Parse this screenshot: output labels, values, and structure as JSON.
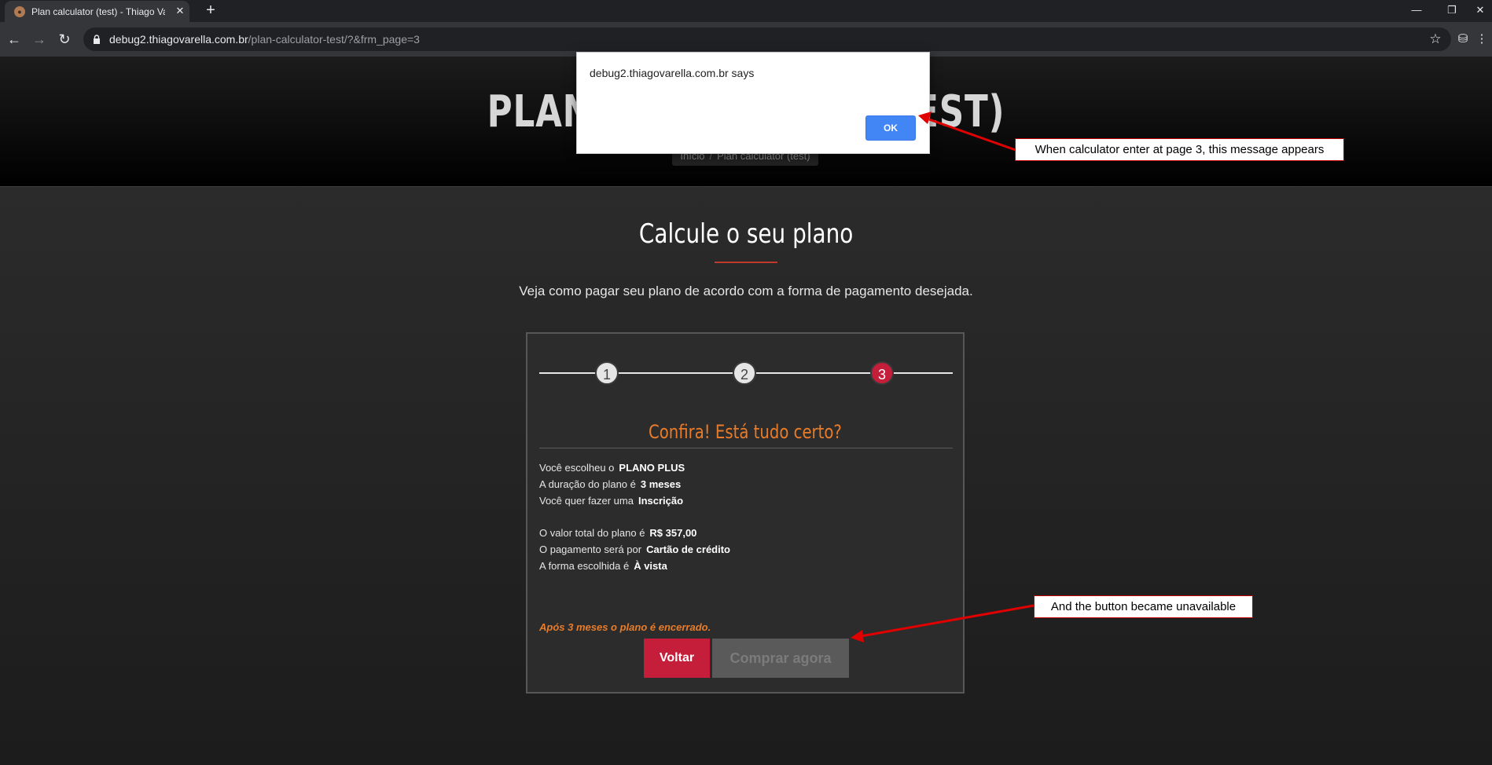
{
  "browser": {
    "tab_title": "Plan calculator (test) - Thiago Var",
    "tab_close": "✕",
    "new_tab": "+",
    "window_controls": {
      "minimize": "—",
      "restore": "❐",
      "close": "✕"
    },
    "nav": {
      "back": "←",
      "forward": "→",
      "reload": "↻"
    },
    "url_host": "debug2.thiagovarella.com.br",
    "url_path": "/plan-calculator-test/?&frm_page=3",
    "icons": {
      "star": "☆",
      "ext": "⛁",
      "menu": "⋮"
    }
  },
  "hero": {
    "title": "PLAN CALCULATOR (TEST)",
    "breadcrumb": {
      "home": "Início",
      "separator": "/",
      "current": "Plan calculator (test)"
    }
  },
  "main": {
    "title": "Calcule o seu plano",
    "subtitle": "Veja como pagar seu plano de acordo com a forma de pagamento desejada."
  },
  "calculator": {
    "steps": [
      "1",
      "2",
      "3"
    ],
    "active_step": 3,
    "confirm_title": "Confira! Está tudo certo?",
    "summary": [
      {
        "label": "Você escolheu o",
        "value": "PLANO PLUS"
      },
      {
        "label": "A duração do plano é",
        "value": "3 meses"
      },
      {
        "label": "Você quer fazer uma",
        "value": "Inscrição"
      },
      {
        "label": "O valor total do plano é",
        "value": "R$ 357,00"
      },
      {
        "label": "O pagamento será por",
        "value": "Cartão de crédito"
      },
      {
        "label": "A forma escolhida é",
        "value": "À vista"
      }
    ],
    "note": "Após 3 meses o plano é encerrado.",
    "back_label": "Voltar",
    "buy_label": "Comprar agora"
  },
  "dialog": {
    "message": "debug2.thiagovarella.com.br says",
    "ok_label": "OK"
  },
  "annotations": {
    "message_note": "When calculator enter at page 3, this message appears",
    "button_note": "And the button became unavailable",
    "color": "#e00000"
  }
}
